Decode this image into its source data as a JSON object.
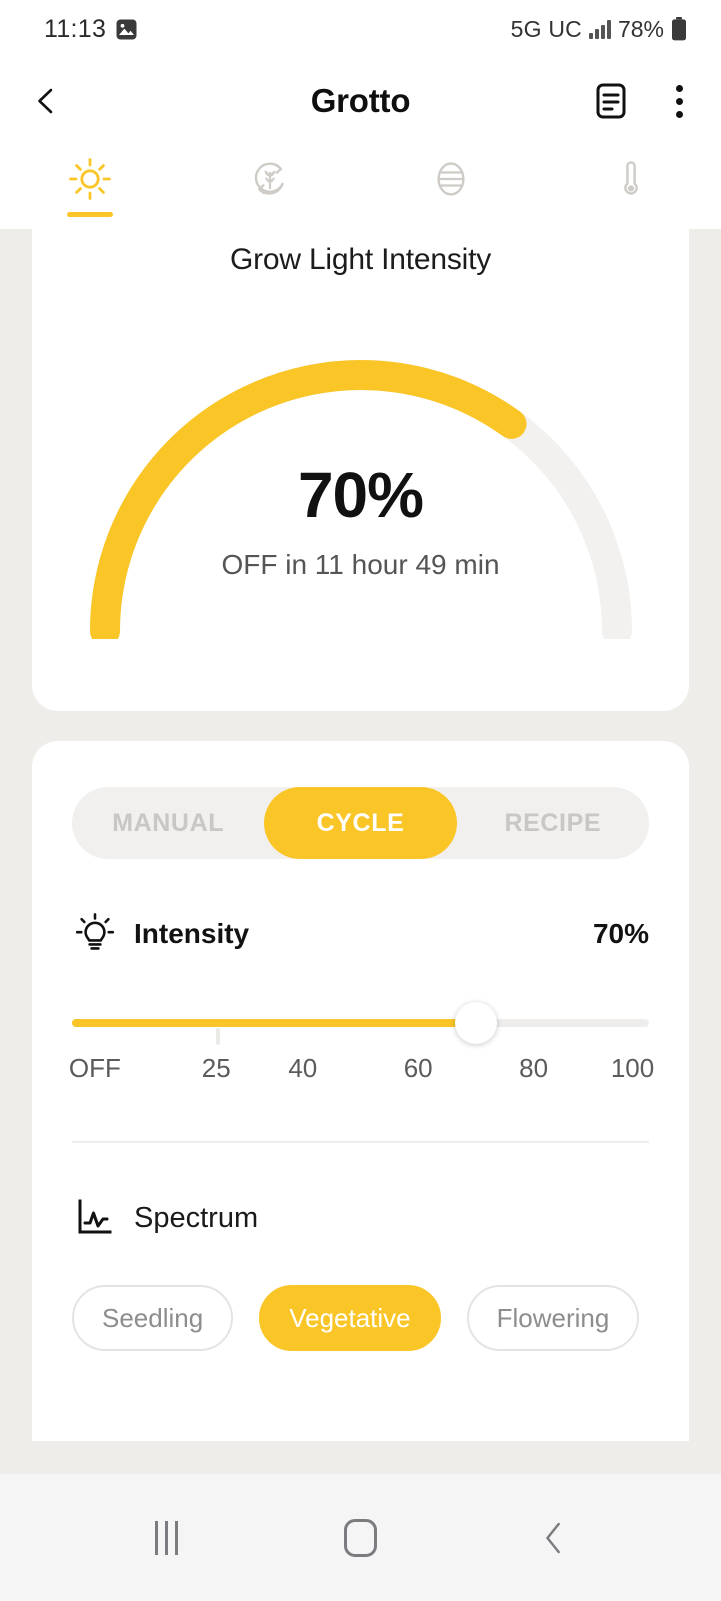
{
  "status_bar": {
    "time": "11:13",
    "photo_icon": "photo-icon",
    "network": "5G UC",
    "signal_icon": "signal-bars-icon",
    "battery_pct": "78%",
    "battery_icon": "battery-icon"
  },
  "header": {
    "back_icon": "chevron-left-icon",
    "title": "Grotto",
    "notes_icon": "notes-icon",
    "more_icon": "kebab-menu-icon"
  },
  "tabs": [
    {
      "id": "light",
      "icon": "sun-icon",
      "active": true
    },
    {
      "id": "recirculation",
      "icon": "leaf-refresh-icon",
      "active": false
    },
    {
      "id": "humidity",
      "icon": "humidity-oval-icon",
      "active": false
    },
    {
      "id": "temperature",
      "icon": "thermometer-icon",
      "active": false
    }
  ],
  "gauge_card": {
    "title": "Grow Light Intensity",
    "value": "70%",
    "subtitle": "OFF in 11 hour 49 min"
  },
  "control_card": {
    "modes": [
      {
        "label": "MANUAL",
        "active": false
      },
      {
        "label": "CYCLE",
        "active": true
      },
      {
        "label": "RECIPE",
        "active": false
      }
    ],
    "intensity": {
      "icon": "light-bulb-icon",
      "label": "Intensity",
      "value": "70%"
    },
    "spectrum": {
      "icon": "spectrum-chart-icon",
      "label": "Spectrum",
      "chips": [
        {
          "label": "Seedling",
          "active": false
        },
        {
          "label": "Vegetative",
          "active": true
        },
        {
          "label": "Flowering",
          "active": false
        }
      ]
    }
  },
  "nav_bar": {
    "recents_icon": "recents-icon",
    "home_icon": "home-icon",
    "back_icon": "nav-back-icon"
  },
  "colors": {
    "accent": "#FAC526",
    "page_bg": "#EFEDEA",
    "card_bg": "#FFFFFF",
    "track_bg": "#EEEDEB",
    "text_primary": "#111111",
    "text_secondary": "#555555",
    "text_muted": "#C9C7C4"
  },
  "chart_data": {
    "type": "gauge",
    "title": "Grow Light Intensity",
    "value": 70,
    "unit": "%",
    "min": 0,
    "max": 100,
    "ylim": [
      0,
      100
    ],
    "annotation": "OFF in 11 hour 49 min",
    "arc_span_degrees": 180,
    "filled_color": "#FAC526",
    "empty_color": "#F2F1EF",
    "grid": false,
    "legend": "none"
  },
  "slider_data": {
    "type": "slider",
    "label": "Intensity",
    "value": 70,
    "min": 0,
    "max": 100,
    "tick_labels": [
      "OFF",
      "25",
      "40",
      "60",
      "80",
      "100"
    ],
    "tick_positions": [
      0,
      25,
      40,
      60,
      80,
      100
    ],
    "fill_color": "#FAC526"
  }
}
